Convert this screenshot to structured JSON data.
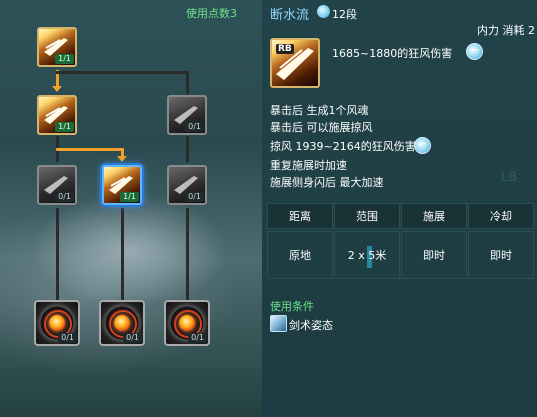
{
  "tree": {
    "points_used": "使用点数3",
    "nodes": [
      {
        "id": "r1c1",
        "level": "1/1",
        "state": "learned"
      },
      {
        "id": "r2c1",
        "level": "1/1",
        "state": "learned"
      },
      {
        "id": "r2c3",
        "level": "0/1",
        "state": "locked"
      },
      {
        "id": "r3c1",
        "level": "0/1",
        "state": "locked"
      },
      {
        "id": "r3c2",
        "level": "1/1",
        "state": "selected"
      },
      {
        "id": "r3c3",
        "level": "0/1",
        "state": "locked"
      },
      {
        "id": "r4c1",
        "level": "0/1",
        "state": "locked"
      },
      {
        "id": "r4c2",
        "level": "0/1",
        "state": "locked"
      },
      {
        "id": "r4c3",
        "level": "0/1",
        "state": "locked"
      }
    ]
  },
  "skill": {
    "name": "断水流",
    "tier_icon": "wind-element-icon",
    "tier": "12段",
    "cost": "内力 消耗 2",
    "key": "RB",
    "damage": "1685~1880的狂风伤害",
    "effects": [
      "暴击后 生成1个风魂",
      "暴击后 可以施展掠风",
      "掠风 1939~2164的狂风伤害",
      "重复施展时加速",
      "施展侧身闪后 最大加速"
    ],
    "ghost": "LB"
  },
  "stats": {
    "headers": [
      "距离",
      "范围",
      "施展",
      "冷却"
    ],
    "values": [
      "原地",
      "2 x 5米",
      "即时",
      "即时"
    ]
  },
  "conditions": {
    "title": "使用条件",
    "stance": "剑术姿态"
  },
  "colors": {
    "active_path": "#f3a12a",
    "selected_border": "#5fb8ff",
    "condition_title": "#6fe08a"
  }
}
